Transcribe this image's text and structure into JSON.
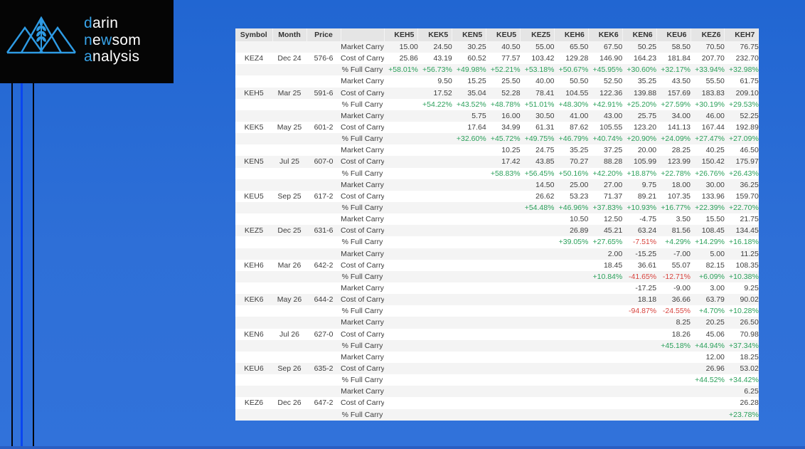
{
  "logo": {
    "icon": "mountains-wheat-icon",
    "accent_color": "#38a3e8",
    "lines": [
      {
        "segments": [
          {
            "t": "d",
            "accent": true
          },
          {
            "t": "arin",
            "accent": false
          }
        ]
      },
      {
        "segments": [
          {
            "t": "n",
            "accent": true
          },
          {
            "t": "e",
            "accent": false
          },
          {
            "t": "w",
            "accent": true
          },
          {
            "t": "som",
            "accent": false
          }
        ]
      },
      {
        "segments": [
          {
            "t": "a",
            "accent": true
          },
          {
            "t": "nalysis",
            "accent": false
          }
        ]
      }
    ]
  },
  "colors": {
    "positive_pct": "#2aa05a",
    "negative_pct": "#d8443e",
    "header_bg": "#e5e5e5",
    "row_alt_bg": "#f4f4f4",
    "background_blue": "#2e6fd7",
    "bottom_bar_blue": "#2a5ec2",
    "stripe_bright_blue": "#0a46f0"
  },
  "table": {
    "headers": {
      "symbol": "Symbol",
      "month": "Month",
      "price": "Price",
      "row_label": ""
    },
    "contracts": [
      "KEH5",
      "KEK5",
      "KEN5",
      "KEU5",
      "KEZ5",
      "KEH6",
      "KEK6",
      "KEN6",
      "KEU6",
      "KEZ6",
      "KEH7"
    ],
    "row_labels": {
      "market": "Market Carry",
      "cost": "Cost of Carry",
      "pct": "% Full Carry"
    },
    "groups": [
      {
        "symbol": "KEZ4",
        "month": "Dec 24",
        "price": "576-6",
        "market": [
          "15.00",
          "24.50",
          "30.25",
          "40.50",
          "55.00",
          "65.50",
          "67.50",
          "50.25",
          "58.50",
          "70.50",
          "76.75"
        ],
        "cost": [
          "25.86",
          "43.19",
          "60.52",
          "77.57",
          "103.42",
          "129.28",
          "146.90",
          "164.23",
          "181.84",
          "207.70",
          "232.70"
        ],
        "pct": [
          "+58.01%",
          "+56.73%",
          "+49.98%",
          "+52.21%",
          "+53.18%",
          "+50.67%",
          "+45.95%",
          "+30.60%",
          "+32.17%",
          "+33.94%",
          "+32.98%"
        ]
      },
      {
        "symbol": "KEH5",
        "month": "Mar 25",
        "price": "591-6",
        "market": [
          "",
          "9.50",
          "15.25",
          "25.50",
          "40.00",
          "50.50",
          "52.50",
          "35.25",
          "43.50",
          "55.50",
          "61.75"
        ],
        "cost": [
          "",
          "17.52",
          "35.04",
          "52.28",
          "78.41",
          "104.55",
          "122.36",
          "139.88",
          "157.69",
          "183.83",
          "209.10"
        ],
        "pct": [
          "",
          "+54.22%",
          "+43.52%",
          "+48.78%",
          "+51.01%",
          "+48.30%",
          "+42.91%",
          "+25.20%",
          "+27.59%",
          "+30.19%",
          "+29.53%"
        ]
      },
      {
        "symbol": "KEK5",
        "month": "May 25",
        "price": "601-2",
        "market": [
          "",
          "",
          "5.75",
          "16.00",
          "30.50",
          "41.00",
          "43.00",
          "25.75",
          "34.00",
          "46.00",
          "52.25"
        ],
        "cost": [
          "",
          "",
          "17.64",
          "34.99",
          "61.31",
          "87.62",
          "105.55",
          "123.20",
          "141.13",
          "167.44",
          "192.89"
        ],
        "pct": [
          "",
          "",
          "+32.60%",
          "+45.72%",
          "+49.75%",
          "+46.79%",
          "+40.74%",
          "+20.90%",
          "+24.09%",
          "+27.47%",
          "+27.09%"
        ]
      },
      {
        "symbol": "KEN5",
        "month": "Jul 25",
        "price": "607-0",
        "market": [
          "",
          "",
          "",
          "10.25",
          "24.75",
          "35.25",
          "37.25",
          "20.00",
          "28.25",
          "40.25",
          "46.50"
        ],
        "cost": [
          "",
          "",
          "",
          "17.42",
          "43.85",
          "70.27",
          "88.28",
          "105.99",
          "123.99",
          "150.42",
          "175.97"
        ],
        "pct": [
          "",
          "",
          "",
          "+58.83%",
          "+56.45%",
          "+50.16%",
          "+42.20%",
          "+18.87%",
          "+22.78%",
          "+26.76%",
          "+26.43%"
        ]
      },
      {
        "symbol": "KEU5",
        "month": "Sep 25",
        "price": "617-2",
        "market": [
          "",
          "",
          "",
          "",
          "14.50",
          "25.00",
          "27.00",
          "9.75",
          "18.00",
          "30.00",
          "36.25"
        ],
        "cost": [
          "",
          "",
          "",
          "",
          "26.62",
          "53.23",
          "71.37",
          "89.21",
          "107.35",
          "133.96",
          "159.70"
        ],
        "pct": [
          "",
          "",
          "",
          "",
          "+54.48%",
          "+46.96%",
          "+37.83%",
          "+10.93%",
          "+16.77%",
          "+22.39%",
          "+22.70%"
        ]
      },
      {
        "symbol": "KEZ5",
        "month": "Dec 25",
        "price": "631-6",
        "market": [
          "",
          "",
          "",
          "",
          "",
          "10.50",
          "12.50",
          "-4.75",
          "3.50",
          "15.50",
          "21.75"
        ],
        "cost": [
          "",
          "",
          "",
          "",
          "",
          "26.89",
          "45.21",
          "63.24",
          "81.56",
          "108.45",
          "134.45"
        ],
        "pct": [
          "",
          "",
          "",
          "",
          "",
          "+39.05%",
          "+27.65%",
          "-7.51%",
          "+4.29%",
          "+14.29%",
          "+16.18%"
        ]
      },
      {
        "symbol": "KEH6",
        "month": "Mar 26",
        "price": "642-2",
        "market": [
          "",
          "",
          "",
          "",
          "",
          "",
          "2.00",
          "-15.25",
          "-7.00",
          "5.00",
          "11.25"
        ],
        "cost": [
          "",
          "",
          "",
          "",
          "",
          "",
          "18.45",
          "36.61",
          "55.07",
          "82.15",
          "108.35"
        ],
        "pct": [
          "",
          "",
          "",
          "",
          "",
          "",
          "+10.84%",
          "-41.65%",
          "-12.71%",
          "+6.09%",
          "+10.38%"
        ]
      },
      {
        "symbol": "KEK6",
        "month": "May 26",
        "price": "644-2",
        "market": [
          "",
          "",
          "",
          "",
          "",
          "",
          "",
          "-17.25",
          "-9.00",
          "3.00",
          "9.25"
        ],
        "cost": [
          "",
          "",
          "",
          "",
          "",
          "",
          "",
          "18.18",
          "36.66",
          "63.79",
          "90.02"
        ],
        "pct": [
          "",
          "",
          "",
          "",
          "",
          "",
          "",
          "-94.87%",
          "-24.55%",
          "+4.70%",
          "+10.28%"
        ]
      },
      {
        "symbol": "KEN6",
        "month": "Jul 26",
        "price": "627-0",
        "market": [
          "",
          "",
          "",
          "",
          "",
          "",
          "",
          "",
          "8.25",
          "20.25",
          "26.50"
        ],
        "cost": [
          "",
          "",
          "",
          "",
          "",
          "",
          "",
          "",
          "18.26",
          "45.06",
          "70.98"
        ],
        "pct": [
          "",
          "",
          "",
          "",
          "",
          "",
          "",
          "",
          "+45.18%",
          "+44.94%",
          "+37.34%"
        ]
      },
      {
        "symbol": "KEU6",
        "month": "Sep 26",
        "price": "635-2",
        "market": [
          "",
          "",
          "",
          "",
          "",
          "",
          "",
          "",
          "",
          "12.00",
          "18.25"
        ],
        "cost": [
          "",
          "",
          "",
          "",
          "",
          "",
          "",
          "",
          "",
          "26.96",
          "53.02"
        ],
        "pct": [
          "",
          "",
          "",
          "",
          "",
          "",
          "",
          "",
          "",
          "+44.52%",
          "+34.42%"
        ]
      },
      {
        "symbol": "KEZ6",
        "month": "Dec 26",
        "price": "647-2",
        "market": [
          "",
          "",
          "",
          "",
          "",
          "",
          "",
          "",
          "",
          "",
          "6.25"
        ],
        "cost": [
          "",
          "",
          "",
          "",
          "",
          "",
          "",
          "",
          "",
          "",
          "26.28"
        ],
        "pct": [
          "",
          "",
          "",
          "",
          "",
          "",
          "",
          "",
          "",
          "",
          "+23.78%"
        ]
      }
    ]
  }
}
